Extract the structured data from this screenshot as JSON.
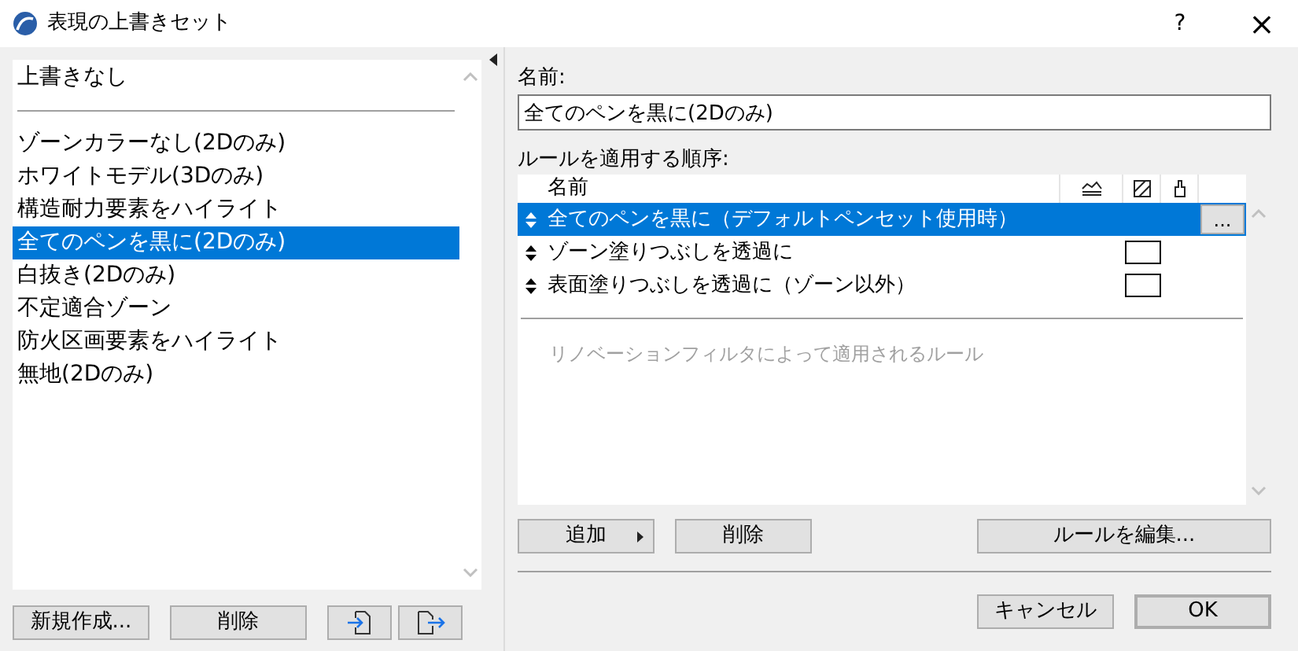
{
  "window": {
    "title": "表現の上書きセット",
    "help": "?",
    "close": "×"
  },
  "sets": {
    "none_item": {
      "label": "上書きなし",
      "selected": false
    },
    "items": [
      {
        "label": "ゾーンカラーなし(2Dのみ)",
        "selected": false
      },
      {
        "label": "ホワイトモデル(3Dのみ)",
        "selected": false
      },
      {
        "label": "構造耐力要素をハイライト",
        "selected": false
      },
      {
        "label": "全てのペンを黒に(2Dのみ)",
        "selected": true
      },
      {
        "label": "白抜き(2Dのみ)",
        "selected": false
      },
      {
        "label": "不定適合ゾーン",
        "selected": false
      },
      {
        "label": "防火区画要素をハイライト",
        "selected": false
      },
      {
        "label": "無地(2Dのみ)",
        "selected": false
      }
    ],
    "buttons": [
      "新規作成...",
      "削除"
    ]
  },
  "name_label": "名前:",
  "name_value": "全てのペンを黒に(2Dのみ)",
  "rules_label": "ルールを適用する順序:",
  "rules_table": {
    "columns": [
      "名前"
    ],
    "rows": [
      {
        "name": "全てのペンを黒に（デフォルトペンセット使用時）",
        "selected": true,
        "fill_swatch": false,
        "more": "..."
      },
      {
        "name": "ゾーン塗りつぶしを透過に",
        "selected": false,
        "fill_swatch": true
      },
      {
        "name": "表面塗りつぶしを透過に（ゾーン以外）",
        "selected": false,
        "fill_swatch": true
      }
    ],
    "renovation_label": "リノベーションフィルタによって適用されるルール"
  },
  "rule_buttons": {
    "add": "追加",
    "delete": "削除",
    "edit": "ルールを編集..."
  },
  "footer_buttons": {
    "cancel": "キャンセル",
    "ok": "OK"
  }
}
